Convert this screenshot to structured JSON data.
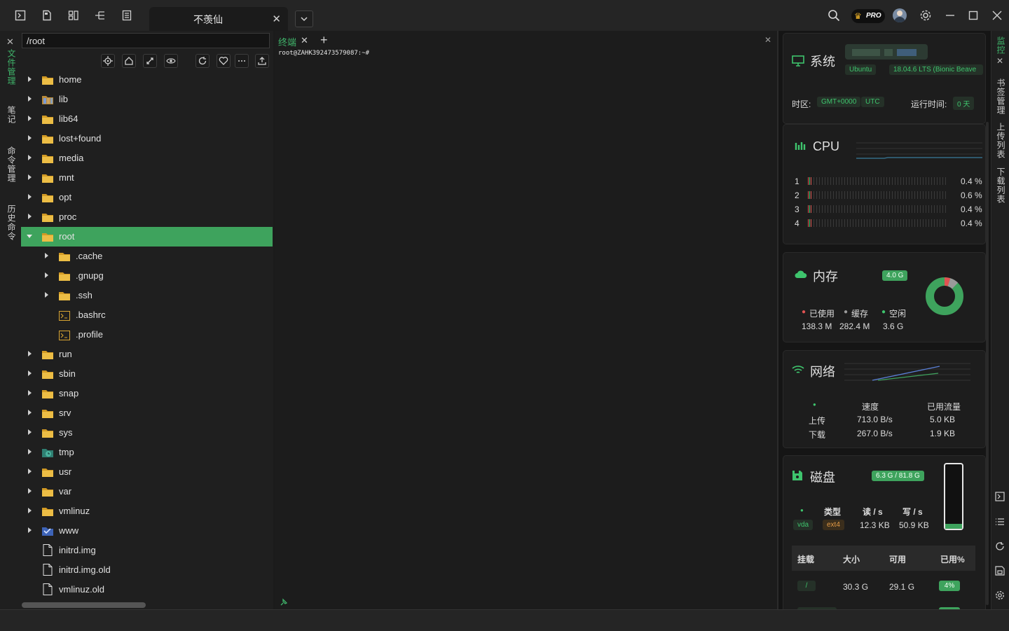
{
  "window": {
    "session_tab": "不羡仙",
    "pro_badge": "PRO"
  },
  "left_rail": {
    "items": [
      "文件管理",
      "笔记",
      "命令管理",
      "历史命令"
    ]
  },
  "file_panel": {
    "path": "/root",
    "tree": [
      {
        "name": "home",
        "type": "folder",
        "depth": 0,
        "expandable": true
      },
      {
        "name": "lib",
        "type": "folder-link",
        "depth": 0,
        "expandable": true
      },
      {
        "name": "lib64",
        "type": "folder",
        "depth": 0,
        "expandable": true
      },
      {
        "name": "lost+found",
        "type": "folder",
        "depth": 0,
        "expandable": true
      },
      {
        "name": "media",
        "type": "folder",
        "depth": 0,
        "expandable": true
      },
      {
        "name": "mnt",
        "type": "folder",
        "depth": 0,
        "expandable": true
      },
      {
        "name": "opt",
        "type": "folder",
        "depth": 0,
        "expandable": true
      },
      {
        "name": "proc",
        "type": "folder",
        "depth": 0,
        "expandable": true
      },
      {
        "name": "root",
        "type": "folder",
        "depth": 0,
        "expandable": true,
        "expanded": true,
        "selected": true
      },
      {
        "name": ".cache",
        "type": "folder",
        "depth": 1,
        "expandable": true
      },
      {
        "name": ".gnupg",
        "type": "folder",
        "depth": 1,
        "expandable": true
      },
      {
        "name": ".ssh",
        "type": "folder",
        "depth": 1,
        "expandable": true
      },
      {
        "name": ".bashrc",
        "type": "script",
        "depth": 1,
        "expandable": false
      },
      {
        "name": ".profile",
        "type": "script",
        "depth": 1,
        "expandable": false
      },
      {
        "name": "run",
        "type": "folder",
        "depth": 0,
        "expandable": true
      },
      {
        "name": "sbin",
        "type": "folder",
        "depth": 0,
        "expandable": true
      },
      {
        "name": "snap",
        "type": "folder",
        "depth": 0,
        "expandable": true
      },
      {
        "name": "srv",
        "type": "folder",
        "depth": 0,
        "expandable": true
      },
      {
        "name": "sys",
        "type": "folder",
        "depth": 0,
        "expandable": true
      },
      {
        "name": "tmp",
        "type": "folder-tmp",
        "depth": 0,
        "expandable": true
      },
      {
        "name": "usr",
        "type": "folder",
        "depth": 0,
        "expandable": true
      },
      {
        "name": "var",
        "type": "folder",
        "depth": 0,
        "expandable": true
      },
      {
        "name": "vmlinuz",
        "type": "folder",
        "depth": 0,
        "expandable": true
      },
      {
        "name": "www",
        "type": "folder-www",
        "depth": 0,
        "expandable": true
      },
      {
        "name": "initrd.img",
        "type": "file",
        "depth": 0,
        "expandable": false
      },
      {
        "name": "initrd.img.old",
        "type": "file",
        "depth": 0,
        "expandable": false
      },
      {
        "name": "vmlinuz.old",
        "type": "file",
        "depth": 0,
        "expandable": false
      }
    ]
  },
  "terminal": {
    "tab_label": "终端",
    "prompt": "root@ZAHK392473579087:~#"
  },
  "monitor": {
    "system": {
      "title": "系统",
      "os": "Ubuntu",
      "version": "18.04.6 LTS (Bionic Beave",
      "tz_label": "时区:",
      "tz_value": "GMT+0000",
      "tz_name": "UTC",
      "uptime_label": "运行时间:",
      "uptime_value": "0 天"
    },
    "cpu": {
      "title": "CPU",
      "cores": [
        {
          "id": "1",
          "usage": "0.4 %"
        },
        {
          "id": "2",
          "usage": "0.6 %"
        },
        {
          "id": "3",
          "usage": "0.4 %"
        },
        {
          "id": "4",
          "usage": "0.4 %"
        }
      ]
    },
    "memory": {
      "title": "内存",
      "total": "4.0 G",
      "used_label": "已使用",
      "cache_label": "缓存",
      "free_label": "空闲",
      "used": "138.3 M",
      "cache": "282.4 M",
      "free": "3.6 G"
    },
    "network": {
      "title": "网络",
      "speed_header": "速度",
      "traffic_header": "已用流量",
      "upload_label": "上传",
      "download_label": "下载",
      "upload_speed": "713.0 B/s",
      "download_speed": "267.0 B/s",
      "upload_total": "5.0 KB",
      "download_total": "1.9 KB"
    },
    "disk": {
      "title": "磁盘",
      "usage": "6.3 G / 81.8 G",
      "type_header": "类型",
      "read_header": "读 / s",
      "write_header": "写 / s",
      "device": "vda",
      "fs": "ext4",
      "read": "12.3 KB",
      "write": "50.9 KB",
      "table_headers": [
        "挂载",
        "大小",
        "可用",
        "已用%"
      ],
      "rows": [
        {
          "mount": "/",
          "size": "30.3 G",
          "avail": "29.1 G",
          "used_pct": "4%"
        }
      ]
    }
  },
  "right_rail": {
    "items": [
      "监控",
      "书签管理",
      "上传列表",
      "下载列表"
    ]
  },
  "colors": {
    "accent": "#3ea35d",
    "folder": "#e8b63d",
    "bg": "#1b1b1b"
  }
}
